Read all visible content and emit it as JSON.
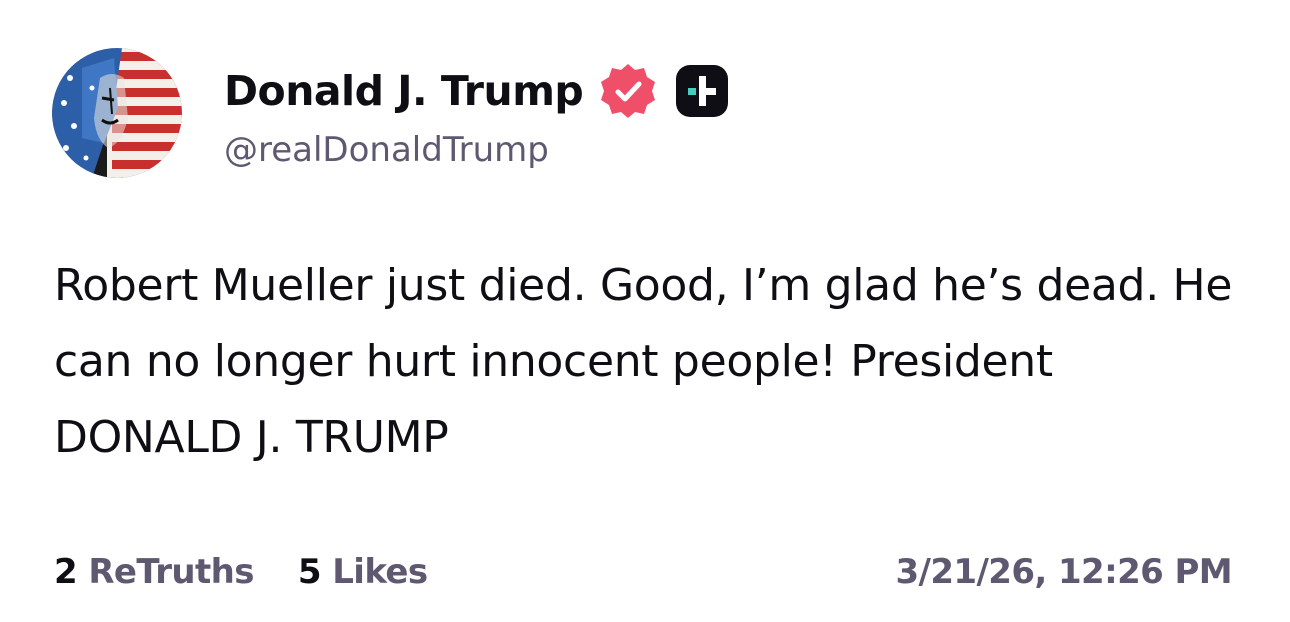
{
  "author": {
    "display_name": "Donald J. Trump",
    "handle": "@realDonaldTrump",
    "avatar_icon": "avatar-flag-portrait",
    "verified_icon": "verified-badge-icon",
    "plus_icon": "plus-badge-icon"
  },
  "post": {
    "text": "Robert Mueller just died. Good, I’m glad he’s dead. He can no longer hurt innocent people! President DONALD J. TRUMP"
  },
  "stats": {
    "retruths_count": "2",
    "retruths_label": "ReTruths",
    "likes_count": "5",
    "likes_label": "Likes"
  },
  "timestamp": "3/21/26, 12:26 PM",
  "colors": {
    "text_primary": "#0f0e14",
    "text_secondary": "#5e5970",
    "verified_badge": "#f04f6a",
    "plus_badge_bg": "#0f0e14",
    "plus_badge_accent": "#3fd0c2"
  }
}
